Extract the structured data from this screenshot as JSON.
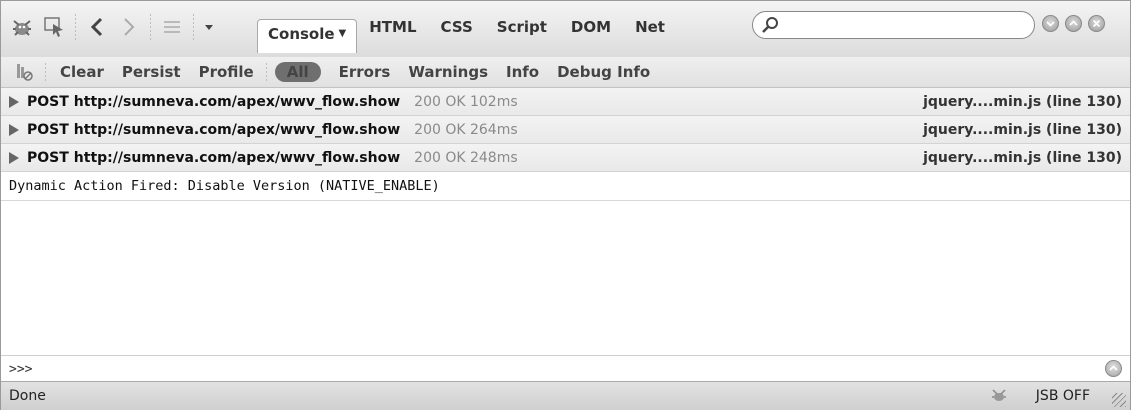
{
  "toolbar": {
    "icons": [
      "firebug-icon",
      "inspect-icon",
      "back-icon",
      "forward-icon",
      "list-icon",
      "dropdown-icon"
    ],
    "tabs": [
      {
        "label": "Console",
        "active": true
      },
      {
        "label": "HTML"
      },
      {
        "label": "CSS"
      },
      {
        "label": "Script"
      },
      {
        "label": "DOM"
      },
      {
        "label": "Net"
      }
    ],
    "search": {
      "placeholder": "",
      "value": ""
    },
    "window_buttons": [
      "minimize",
      "maximize",
      "close"
    ]
  },
  "filterbar": {
    "items": [
      "Clear",
      "Persist",
      "Profile",
      "All",
      "Errors",
      "Warnings",
      "Info",
      "Debug Info"
    ],
    "active": "All"
  },
  "log": {
    "requests": [
      {
        "method": "POST",
        "url": "http://sumneva.com/apex/wwv_flow.show",
        "status": "200 OK 102ms",
        "source": "jquery....min.js (line 130)"
      },
      {
        "method": "POST",
        "url": "http://sumneva.com/apex/wwv_flow.show",
        "status": "200 OK 264ms",
        "source": "jquery....min.js (line 130)"
      },
      {
        "method": "POST",
        "url": "http://sumneva.com/apex/wwv_flow.show",
        "status": "200 OK 248ms",
        "source": "jquery....min.js (line 130)"
      }
    ],
    "message": "Dynamic Action Fired: Disable Version (NATIVE_ENABLE)"
  },
  "command": {
    "prompt": ">>>",
    "value": ""
  },
  "statusbar": {
    "status": "Done",
    "jsb": "JSB OFF"
  },
  "colors": {
    "pill_bg": "#6f6f6f",
    "toolbar_bg": "#e6e6e6",
    "row_bg": "#eeeeee"
  }
}
